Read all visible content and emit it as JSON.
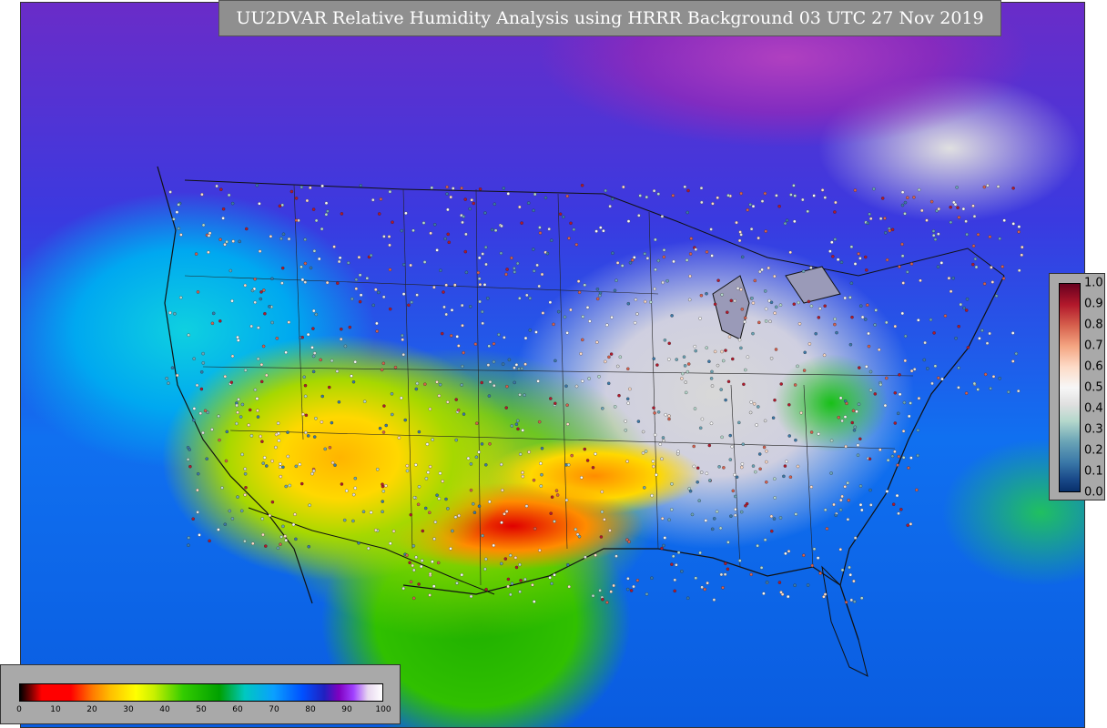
{
  "title": "UU2DVAR Relative Humidity Analysis using HRRR Background 03 UTC 27 Nov 2019",
  "map": {
    "projection": "Lambert conformal (CONUS)",
    "field": "relative humidity analysis",
    "stations": "observation station dots overlaid (innovation colored)"
  },
  "legend_right": {
    "ticks": [
      "1.0",
      "0.9",
      "0.8",
      "0.7",
      "0.6",
      "0.5",
      "0.4",
      "0.3",
      "0.2",
      "0.1",
      "0.0"
    ],
    "colors": [
      "#67001f",
      "#b2182b",
      "#d6604d",
      "#f4a582",
      "#fddbc7",
      "#f7f7f7",
      "#e0e0e0",
      "#b5d8cc",
      "#6aa4b6",
      "#3a78a8",
      "#08306b"
    ]
  },
  "legend_bottom": {
    "ticks": [
      "0",
      "10",
      "20",
      "30",
      "40",
      "50",
      "60",
      "70",
      "80",
      "90",
      "100"
    ],
    "colors": [
      "#000000",
      "#ff0000",
      "#ff7a00",
      "#ffff00",
      "#33cc00",
      "#00a000",
      "#00c8c0",
      "#0aa0ff",
      "#2020c0",
      "#8000c0",
      "#ffffff"
    ]
  }
}
